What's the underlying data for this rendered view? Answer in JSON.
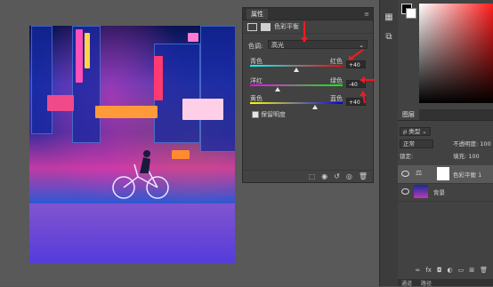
{
  "properties": {
    "panel_tab": "属性",
    "panel_ctrl": "≡",
    "adjustment_name": "色彩平衡",
    "tone_label": "色调:",
    "tone_value": "高光",
    "sliders": [
      {
        "left": "青色",
        "right": "红色",
        "value": "+40",
        "level": 0.5
      },
      {
        "left": "洋红",
        "right": "绿色",
        "value": "-40",
        "level": 0.3
      },
      {
        "left": "黄色",
        "right": "蓝色",
        "value": "+40",
        "level": 0.7
      }
    ],
    "preserve_luminosity_label": "保留明度",
    "preserve_luminosity_checked": true
  },
  "layers": {
    "panel_tab": "图层",
    "kind_filter": "类型",
    "blend_mode": "正常",
    "opacity_label": "不透明度: 100",
    "lock_label": "锁定:",
    "fill_label": "填充: 100",
    "items": [
      {
        "name": "色彩平衡 1",
        "type": "adjustment"
      },
      {
        "name": "背景",
        "type": "image"
      }
    ],
    "bottom_tabs": [
      "通道",
      "路径"
    ]
  },
  "accent": "#ff1d1d",
  "annotation_color": "#ee1b24"
}
